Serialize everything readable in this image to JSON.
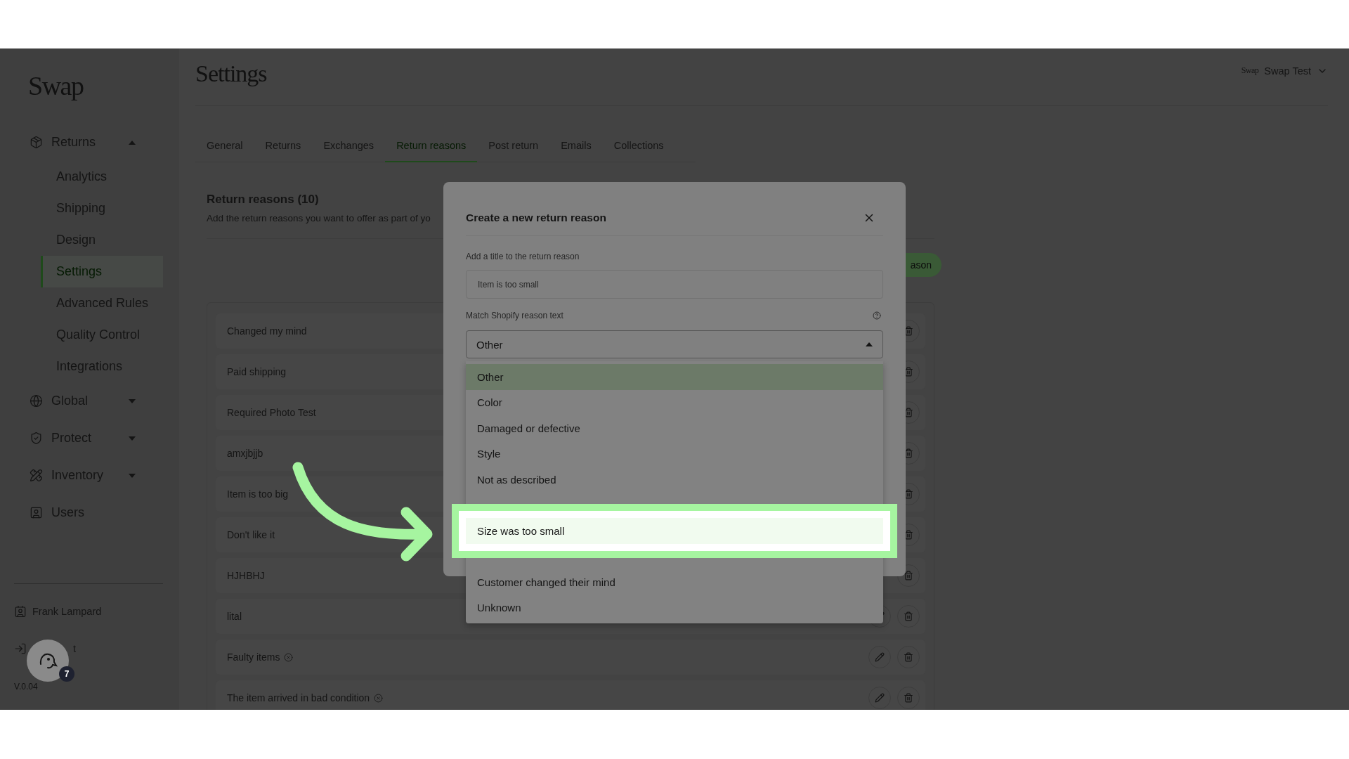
{
  "sidebar": {
    "logo": "Swap",
    "nav": [
      {
        "label": "Returns",
        "expanded": true,
        "children": [
          {
            "label": "Analytics",
            "selected": false
          },
          {
            "label": "Shipping",
            "selected": false
          },
          {
            "label": "Design",
            "selected": false
          },
          {
            "label": "Settings",
            "selected": true
          },
          {
            "label": "Advanced Rules",
            "selected": false
          },
          {
            "label": "Quality Control",
            "selected": false
          },
          {
            "label": "Integrations",
            "selected": false
          }
        ]
      },
      {
        "label": "Global",
        "expanded": false
      },
      {
        "label": "Protect",
        "expanded": false
      },
      {
        "label": "Inventory",
        "expanded": false
      },
      {
        "label": "Users"
      }
    ],
    "user": "Frank Lampard",
    "logout": "t",
    "version": "V.0.04",
    "chat_badge": "7"
  },
  "header": {
    "title": "Settings",
    "account_logo": "Swap",
    "account": "Swap Test"
  },
  "tabs": [
    {
      "label": "General",
      "selected": false
    },
    {
      "label": "Returns",
      "selected": false
    },
    {
      "label": "Exchanges",
      "selected": false
    },
    {
      "label": "Return reasons",
      "selected": true
    },
    {
      "label": "Post return",
      "selected": false
    },
    {
      "label": "Emails",
      "selected": false
    },
    {
      "label": "Collections",
      "selected": false
    }
  ],
  "section": {
    "title": "Return reasons (10)",
    "subtitle": "Add the return reasons you want to offer as part of yo",
    "add_button": "ason"
  },
  "reasons": [
    {
      "name": "Changed my mind",
      "kind": "plain"
    },
    {
      "name": "Paid shipping",
      "kind": "plain"
    },
    {
      "name": "Required Photo Test",
      "kind": "plain"
    },
    {
      "name": "amxjbjjb",
      "kind": "plain"
    },
    {
      "name": "Item is too big",
      "kind": "plain"
    },
    {
      "name": "Don't like it",
      "kind": "plain"
    },
    {
      "name": "HJHBHJ",
      "kind": "plain"
    },
    {
      "name": "lital",
      "kind": "plain",
      "editable": true
    },
    {
      "name": "Faulty items",
      "kind": "flagged",
      "editable": true
    },
    {
      "name": "The item arrived in bad condition",
      "kind": "flagged",
      "editable": true
    }
  ],
  "modal": {
    "title": "Create a new return reason",
    "title_label": "Add a title to the return reason",
    "title_value": "Item is too small",
    "match_label": "Match Shopify reason text",
    "select_value": "Other",
    "options": [
      {
        "label": "Other",
        "selected": true,
        "highlighted": false
      },
      {
        "label": "Color",
        "selected": false,
        "highlighted": false
      },
      {
        "label": "Damaged or defective",
        "selected": false,
        "highlighted": false
      },
      {
        "label": "Style",
        "selected": false,
        "highlighted": false
      },
      {
        "label": "Not as described",
        "selected": false,
        "highlighted": false
      },
      {
        "selected": false,
        "highlighted": false
      },
      {
        "label": "Size was too small",
        "selected": false,
        "highlighted": true
      },
      {
        "selected": false,
        "highlighted": false
      },
      {
        "label": "Customer changed their mind",
        "selected": false,
        "highlighted": false
      },
      {
        "label": "Unknown",
        "selected": false,
        "highlighted": false
      }
    ]
  }
}
